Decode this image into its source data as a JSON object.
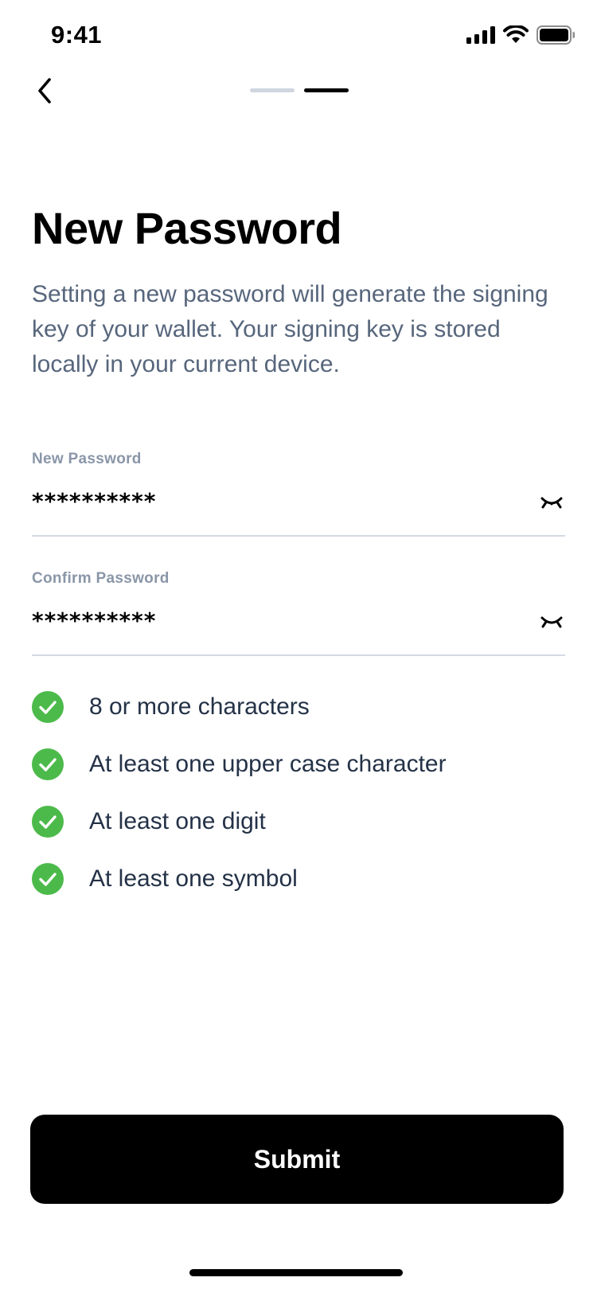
{
  "status_bar": {
    "time": "9:41",
    "icons": [
      "cellular-signal-icon",
      "wifi-icon",
      "battery-icon"
    ]
  },
  "nav": {
    "back_icon": "chevron-left-icon",
    "steps_total": 2,
    "current_step": 2
  },
  "header": {
    "title": "New Password",
    "description": "Setting a new password will generate the signing key of your wallet. Your signing key is stored locally in your current device."
  },
  "form": {
    "new_password": {
      "label": "New Password",
      "value": "**********",
      "toggle_icon": "eye-closed-icon"
    },
    "confirm_password": {
      "label": "Confirm Password",
      "value": "**********",
      "toggle_icon": "eye-closed-icon"
    }
  },
  "requirements": [
    {
      "text": "8 or more characters",
      "met": true
    },
    {
      "text": "At least one upper case character",
      "met": true
    },
    {
      "text": "At least one digit",
      "met": true
    },
    {
      "text": "At least one symbol",
      "met": true
    }
  ],
  "submit": {
    "label": "Submit"
  },
  "colors": {
    "accent": "#000000",
    "check_green": "#4cba4a",
    "description_text": "#57667c",
    "label_text": "#8a96a8",
    "step_inactive": "#cfd6df"
  }
}
